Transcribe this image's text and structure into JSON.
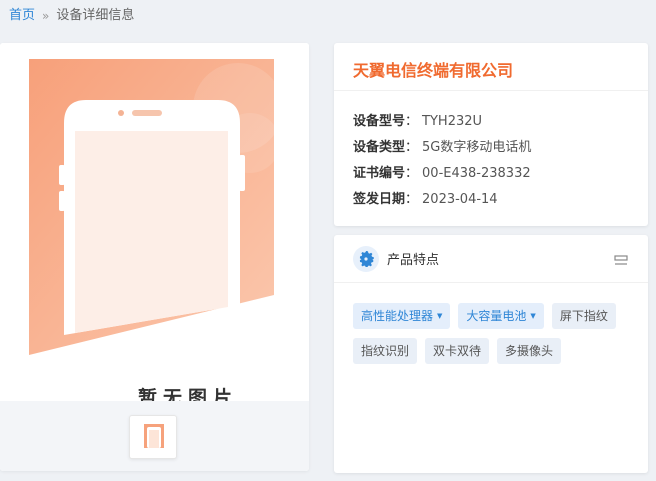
{
  "breadcrumb": {
    "home": "首页",
    "separator": "»",
    "current": "设备详细信息"
  },
  "gallery": {
    "placeholder_text": "暂无图片",
    "thumbnail_caption": "....",
    "colors": {
      "accent_orange": "#f58a5e",
      "accent_light": "#fcd0bb"
    }
  },
  "company": {
    "name": "天翼电信终端有限公司",
    "fields": [
      {
        "label": "设备型号",
        "value": "TYH232U"
      },
      {
        "label": "设备类型",
        "value": "5G数字移动电话机"
      },
      {
        "label": "证书编号",
        "value": "00-E438-238332"
      },
      {
        "label": "签发日期",
        "value": "2023-04-14"
      }
    ],
    "colon": "："
  },
  "features": {
    "title": "产品特点",
    "tags_row1": [
      {
        "label": "高性能处理器",
        "dropdown": true,
        "style": "blue"
      },
      {
        "label": "大容量电池",
        "dropdown": true,
        "style": "blue"
      },
      {
        "label": "屏下指纹",
        "dropdown": false,
        "style": "gray"
      }
    ],
    "tags_row2": [
      {
        "label": "指纹识别",
        "style": "gray"
      },
      {
        "label": "双卡双待",
        "style": "gray"
      },
      {
        "label": "多摄像头",
        "style": "gray"
      }
    ],
    "caret_glyph": "▼"
  },
  "theme": {
    "brand_blue": "#2f86d6",
    "title_orange": "#f06a2f",
    "page_bg": "#eef1f5"
  }
}
